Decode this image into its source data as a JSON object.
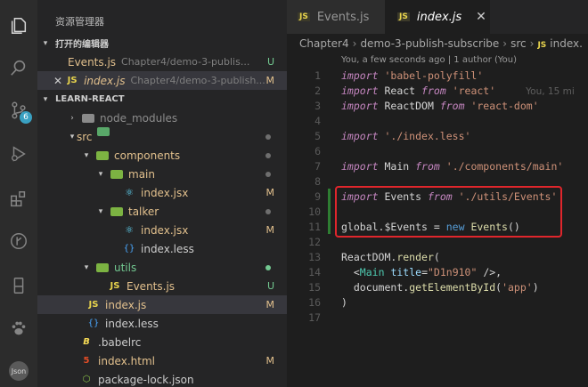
{
  "sidebar": {
    "title": "资源管理器",
    "open_editors": {
      "label": "打开的编辑器",
      "items": [
        {
          "name": "Events.js",
          "path": "Chapter4/demo-3-publis...",
          "status": "U"
        },
        {
          "name": "index.js",
          "path": "Chapter4/demo-3-publish...",
          "status": "M"
        }
      ]
    },
    "project": {
      "label": "LEARN-REACT",
      "tree": [
        {
          "name": "node_modules"
        },
        {
          "name": "src"
        },
        {
          "name": "components"
        },
        {
          "name": "main"
        },
        {
          "name": "index.jsx",
          "status": "M"
        },
        {
          "name": "talker"
        },
        {
          "name": "index.jsx",
          "status": "M"
        },
        {
          "name": "index.less"
        },
        {
          "name": "utils"
        },
        {
          "name": "Events.js",
          "status": "U"
        },
        {
          "name": "index.js",
          "status": "M"
        },
        {
          "name": "index.less"
        },
        {
          "name": ".babelrc"
        },
        {
          "name": "index.html",
          "status": "M"
        },
        {
          "name": "package-lock.json"
        }
      ]
    }
  },
  "activity": {
    "scm_badge": "6",
    "json_label": "Json"
  },
  "tabs": [
    {
      "label": "Events.js",
      "icon": "JS"
    },
    {
      "label": "index.js",
      "icon": "JS",
      "close": "✕"
    }
  ],
  "breadcrumb": {
    "parts": [
      "Chapter4",
      "demo-3-publish-subscribe",
      "src",
      "index."
    ],
    "icon": "JS"
  },
  "blame": "You, a few seconds ago | 1 author (You)",
  "code": {
    "line_numbers": [
      "1",
      "2",
      "3",
      "4",
      "5",
      "6",
      "7",
      "8",
      "9",
      "10",
      "11",
      "12",
      "13",
      "14",
      "15",
      "16",
      "17"
    ],
    "ghost_blame": "You, 15 mi",
    "tokens": {
      "import": "import",
      "from": "from",
      "new": "new",
      "l1_str": "'babel-polyfill'",
      "l2_id": "React",
      "l2_str": "'react'",
      "l3_id": "ReactDOM",
      "l3_str": "'react-dom'",
      "l5_str": "'./index.less'",
      "l7_id": "Main",
      "l7_str": "'./components/main'",
      "l9_id": "Events",
      "l9_str": "'./utils/Events'",
      "l11_global": "global",
      "l11_prop": ".$Events",
      "l11_eq": " = ",
      "l11_cls": "Events",
      "l11_paren": "()",
      "l13_obj": "ReactDOM",
      "l13_dot": ".",
      "l13_fn": "render",
      "l13_paren": "(",
      "l14_open": "<",
      "l14_tag": "Main",
      "l14_attr": "title",
      "l14_eq": "=",
      "l14_str": "\"D1n910\"",
      "l14_close": " />",
      "l14_comma": ",",
      "l15_obj": "document",
      "l15_dot": ".",
      "l15_fn": "getElementById",
      "l15_open": "(",
      "l15_str": "'app'",
      "l15_close": ")",
      "l16": ")"
    }
  },
  "colors": {
    "highlight_box": "#e0262c",
    "accent": "#3aa1c2"
  }
}
